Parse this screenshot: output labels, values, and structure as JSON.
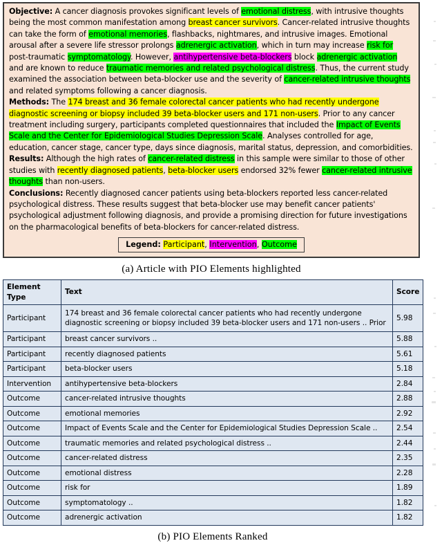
{
  "figure_a": {
    "caption": "(a) Article with PIO Elements highlighted",
    "abstract": {
      "objective_label": "Objective:",
      "objective_text": [
        " A cancer diagnosis provokes significant levels of ",
        "emotional distress",
        ", with intrusive thoughts being the most common manifestation among ",
        "breast cancer survivors",
        ". Cancer-related intrusive thoughts can take the form of ",
        "emotional memories",
        ", flashbacks, nightmares, and intrusive images. Emotional arousal after a severe life stressor prolongs ",
        "adrenergic activation",
        ", which in turn may increase ",
        "risk for",
        " post-traumatic ",
        "symptomatology",
        ". However, ",
        "antihypertensive beta-blockers",
        " block ",
        "adrenergic activation",
        " and are known to reduce ",
        "traumatic memories and related psychological distress",
        ". Thus, the current study examined the association between beta-blocker use and the severity of ",
        "cancer-related intrusive thoughts",
        " and related symptoms following a cancer diagnosis."
      ],
      "methods_label": "Methods:",
      "methods_text": [
        " The ",
        "174 breast and 36 female colorectal cancer patients who had recently undergone diagnostic screening or biopsy included 39 beta-blocker users and 171 non-users",
        ". Prior to any cancer treatment including surgery, participants completed questionnaires that included the ",
        "Impact of Events Scale and the Center for Epidemiological Studies Depression Scale",
        ". Analyses controlled for age, education, cancer stage, cancer type, days since diagnosis, marital status, depression, and comorbidities."
      ],
      "results_label": "Results:",
      "results_text": [
        " Although the high rates of ",
        "cancer-related distress",
        " in this sample were similar to those of other studies with ",
        "recently diagnosed patients",
        ", ",
        "beta-blocker users",
        " endorsed 32% fewer ",
        "cancer-related intrusive thoughts",
        " than non-users."
      ],
      "conclusions_label": "Conclusions:",
      "conclusions_text": " Recently diagnosed cancer patients using beta-blockers reported less cancer-related psychological distress. These results suggest that beta-blocker use may benefit cancer patients' psychological adjustment following diagnosis, and provide a promising direction for future investigations on the pharmacological benefits of beta-blockers for cancer-related distress."
    },
    "legend": {
      "title": "Legend:",
      "participant": "Participant",
      "intervention": "Intervention",
      "outcome": "Outcome",
      "separator_1": ", ",
      "separator_2": ", ",
      "colors": {
        "participant": "#ffff00",
        "intervention": "#ff00ff",
        "outcome": "#00ff00",
        "box_background": "#f9e4d6"
      }
    }
  },
  "figure_b": {
    "caption": "(b) PIO Elements Ranked",
    "table": {
      "columns": [
        "Element Type",
        "Text",
        "Score"
      ],
      "rows": [
        {
          "type": "Participant",
          "text": "174 breast and 36 female colorectal cancer patients who had recently undergone diagnostic screening or biopsy included 39 beta-blocker users and 171 non-users .. Prior",
          "score": "5.98"
        },
        {
          "type": "Participant",
          "text": "breast cancer survivors ..",
          "score": "5.88"
        },
        {
          "type": "Participant",
          "text": "recently diagnosed patients",
          "score": "5.61"
        },
        {
          "type": "Participant",
          "text": "beta-blocker users",
          "score": "5.18"
        },
        {
          "type": "Intervention",
          "text": "antihypertensive beta-blockers",
          "score": "2.84"
        },
        {
          "type": "Outcome",
          "text": "cancer-related intrusive thoughts",
          "score": "2.88"
        },
        {
          "type": "Outcome",
          "text": "emotional memories",
          "score": "2.92"
        },
        {
          "type": "Outcome",
          "text": "Impact of Events Scale and the Center for Epidemiological Studies Depression Scale ..",
          "score": "2.54"
        },
        {
          "type": "Outcome",
          "text": "traumatic memories and related psychological distress ..",
          "score": "2.44"
        },
        {
          "type": "Outcome",
          "text": "cancer-related distress",
          "score": "2.35"
        },
        {
          "type": "Outcome",
          "text": "emotional distress",
          "score": "2.28"
        },
        {
          "type": "Outcome",
          "text": "risk for",
          "score": "1.89"
        },
        {
          "type": "Outcome",
          "text": "symptomatology ..",
          "score": "1.82"
        },
        {
          "type": "Outcome",
          "text": "adrenergic activation",
          "score": "1.82"
        }
      ]
    }
  }
}
